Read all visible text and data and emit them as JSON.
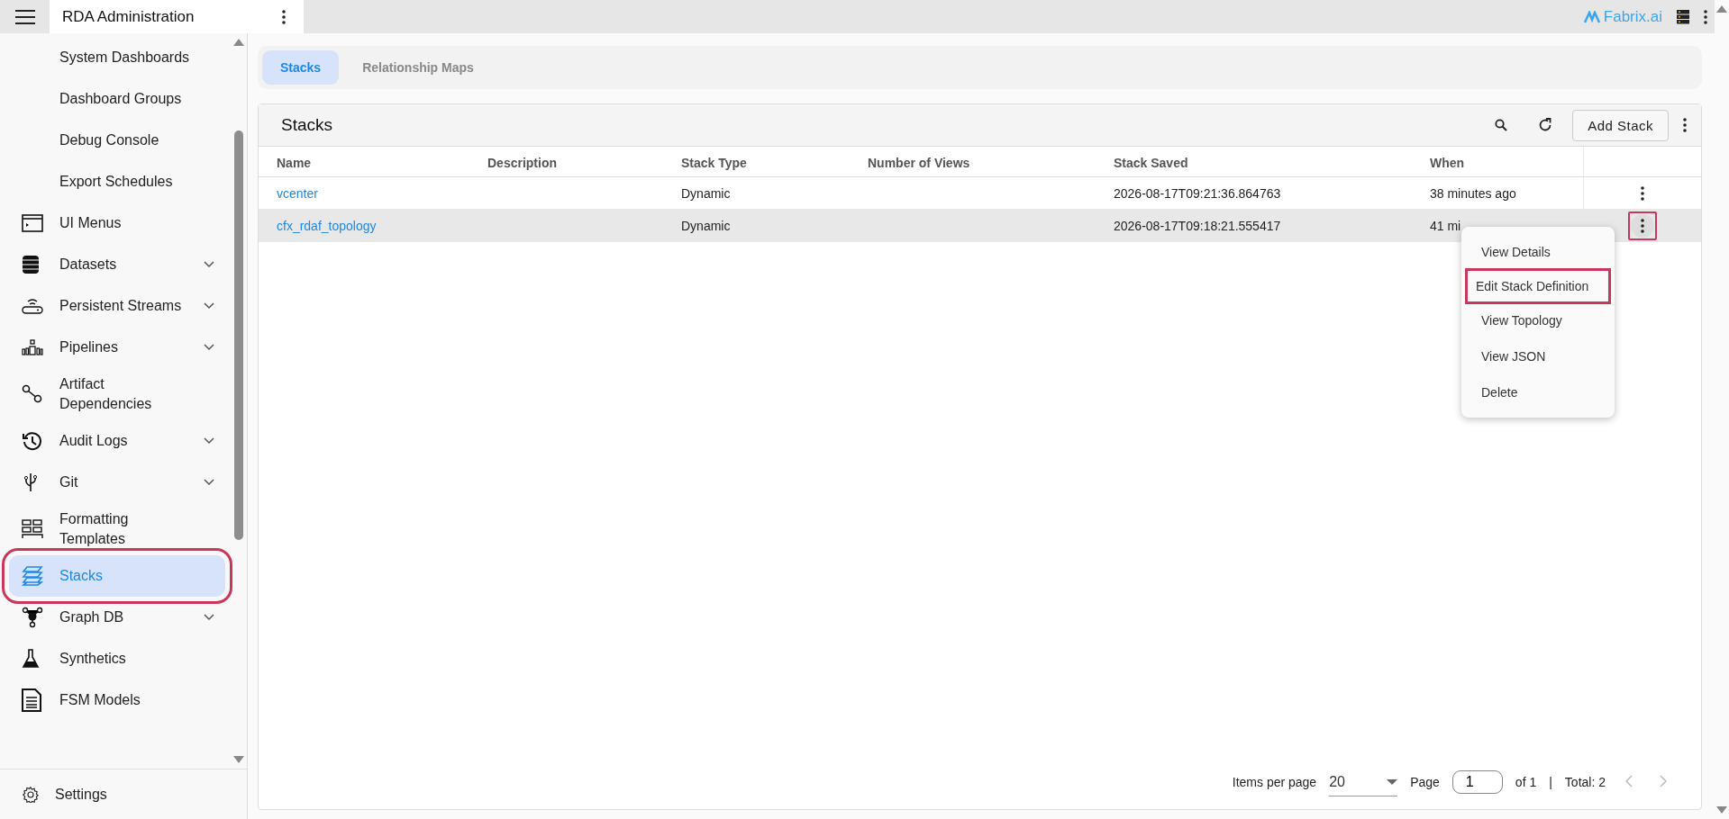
{
  "header": {
    "title": "RDA Administration",
    "brand": "Fabrix.ai"
  },
  "sidebar": {
    "items": [
      {
        "label": "System Dashboards",
        "expandable": false,
        "selected": false,
        "highlighted": false
      },
      {
        "label": "Dashboard Groups",
        "expandable": false,
        "selected": false,
        "highlighted": false
      },
      {
        "label": "Debug Console",
        "expandable": false,
        "selected": false,
        "highlighted": false
      },
      {
        "label": "Export Schedules",
        "expandable": false,
        "selected": false,
        "highlighted": false
      },
      {
        "label": "UI Menus",
        "expandable": false,
        "selected": false,
        "highlighted": false
      },
      {
        "label": "Datasets",
        "expandable": true,
        "selected": false,
        "highlighted": false
      },
      {
        "label": "Persistent Streams",
        "expandable": true,
        "selected": false,
        "highlighted": false
      },
      {
        "label": "Pipelines",
        "expandable": true,
        "selected": false,
        "highlighted": false
      },
      {
        "label": "Artifact Dependencies",
        "expandable": false,
        "selected": false,
        "highlighted": false
      },
      {
        "label": "Audit Logs",
        "expandable": true,
        "selected": false,
        "highlighted": false
      },
      {
        "label": "Git",
        "expandable": true,
        "selected": false,
        "highlighted": false
      },
      {
        "label": "Formatting Templates",
        "expandable": false,
        "selected": false,
        "highlighted": false
      },
      {
        "label": "Stacks",
        "expandable": false,
        "selected": true,
        "highlighted": true
      },
      {
        "label": "Graph DB",
        "expandable": true,
        "selected": false,
        "highlighted": false
      },
      {
        "label": "Synthetics",
        "expandable": false,
        "selected": false,
        "highlighted": false
      },
      {
        "label": "FSM Models",
        "expandable": false,
        "selected": false,
        "highlighted": false
      }
    ],
    "settings": "Settings"
  },
  "tabs": [
    {
      "label": "Stacks",
      "selected": true
    },
    {
      "label": "Relationship Maps",
      "selected": false
    }
  ],
  "card": {
    "title": "Stacks",
    "add_button": "Add Stack"
  },
  "table": {
    "columns": [
      "Name",
      "Description",
      "Stack Type",
      "Number of Views",
      "Stack Saved",
      "When"
    ],
    "rows": [
      {
        "cells": [
          "vcenter",
          "",
          "Dynamic",
          "",
          "2026-08-17T09:21:36.864763",
          "38 minutes ago"
        ],
        "selected": false,
        "menu_open": false,
        "highlighted": false
      },
      {
        "cells": [
          "cfx_rdaf_topology",
          "",
          "Dynamic",
          "",
          "2026-08-17T09:18:21.555417",
          "41 mi"
        ],
        "selected": true,
        "menu_open": true,
        "highlighted": true
      }
    ]
  },
  "row_menu": {
    "items": [
      {
        "label": "View Details",
        "highlighted": false
      },
      {
        "label": "Edit Stack Definition",
        "highlighted": true
      },
      {
        "label": "View Topology",
        "highlighted": false
      },
      {
        "label": "View JSON",
        "highlighted": false
      },
      {
        "label": "Delete",
        "highlighted": false
      }
    ]
  },
  "pagination": {
    "items_per_page_label": "Items per page",
    "page_size": "20",
    "page_label": "Page",
    "page": "1",
    "of": "of 1",
    "separator": "|",
    "total": "Total: 2"
  }
}
